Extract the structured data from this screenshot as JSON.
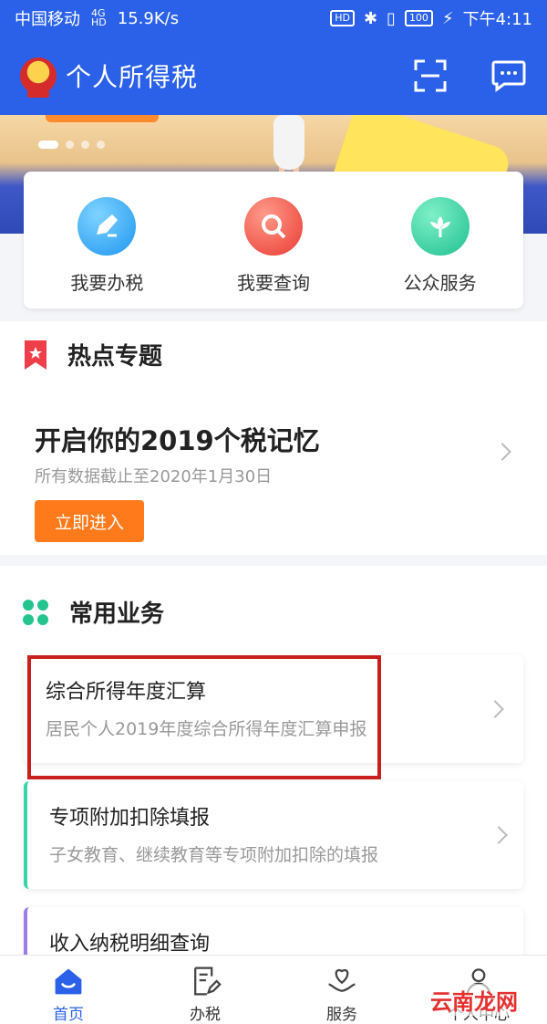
{
  "status_bar": {
    "carrier": "中国移动",
    "network_badge": "4G",
    "network_badge_sub": "HD",
    "speed": "15.9K/s",
    "hd": "HD",
    "battery": "100",
    "time": "下午4:11"
  },
  "header": {
    "title": "个人所得税",
    "scan_icon": "scan-icon",
    "message_icon": "message-icon"
  },
  "banner": {
    "slides_total": 4,
    "active_slide": 1
  },
  "quick_actions": [
    {
      "label": "我要办税",
      "icon": "pen-icon",
      "color": "#2aa7f5"
    },
    {
      "label": "我要查询",
      "icon": "search-icon",
      "color": "#f04a3c"
    },
    {
      "label": "公众服务",
      "icon": "flower-icon",
      "color": "#26c59a"
    }
  ],
  "hot_topics": {
    "section_title": "热点专题",
    "headline": "开启你的2019个税记忆",
    "subtitle": "所有数据截止至2020年1月30日",
    "button_label": "立即进入"
  },
  "common_business": {
    "section_title": "常用业务",
    "items": [
      {
        "title": "综合所得年度汇算",
        "desc": "居民个人2019年度综合所得年度汇算申报"
      },
      {
        "title": "专项附加扣除填报",
        "desc": "子女教育、继续教育等专项附加扣除的填报"
      },
      {
        "title": "收入纳税明细查询",
        "desc": ""
      }
    ]
  },
  "tabbar": {
    "tabs": [
      {
        "label": "首页",
        "icon": "home-icon",
        "active": true
      },
      {
        "label": "办税",
        "icon": "document-edit-icon",
        "active": false
      },
      {
        "label": "服务",
        "icon": "heart-hand-icon",
        "active": false
      },
      {
        "label": "个人中心",
        "icon": "person-icon",
        "active": false
      }
    ]
  },
  "watermark": {
    "text": "云南龙网"
  },
  "colors": {
    "brand_blue": "#2a61e8",
    "accent_orange": "#ff7a1a",
    "highlight_red": "#c81e1e"
  }
}
